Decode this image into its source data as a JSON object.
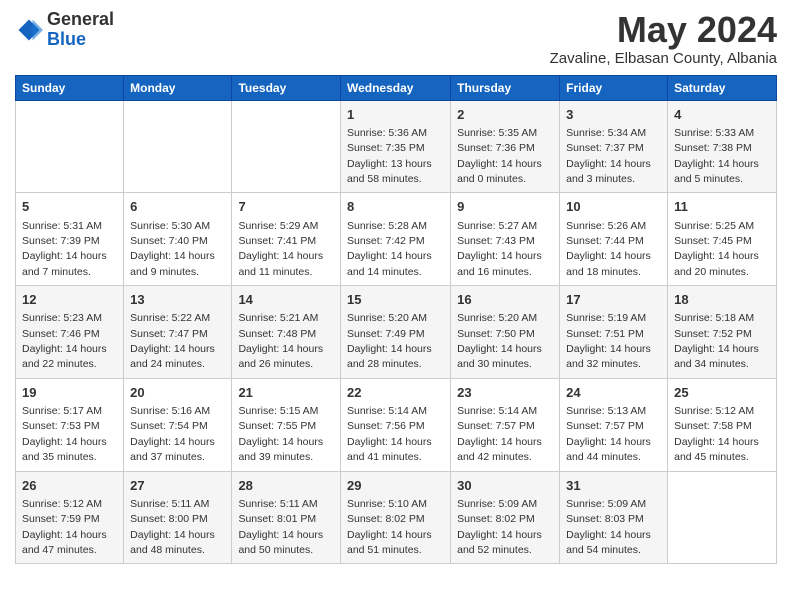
{
  "logo": {
    "general": "General",
    "blue": "Blue"
  },
  "title": "May 2024",
  "location": "Zavaline, Elbasan County, Albania",
  "days_of_week": [
    "Sunday",
    "Monday",
    "Tuesday",
    "Wednesday",
    "Thursday",
    "Friday",
    "Saturday"
  ],
  "weeks": [
    [
      {
        "day": "",
        "info": ""
      },
      {
        "day": "",
        "info": ""
      },
      {
        "day": "",
        "info": ""
      },
      {
        "day": "1",
        "info": "Sunrise: 5:36 AM\nSunset: 7:35 PM\nDaylight: 13 hours and 58 minutes."
      },
      {
        "day": "2",
        "info": "Sunrise: 5:35 AM\nSunset: 7:36 PM\nDaylight: 14 hours and 0 minutes."
      },
      {
        "day": "3",
        "info": "Sunrise: 5:34 AM\nSunset: 7:37 PM\nDaylight: 14 hours and 3 minutes."
      },
      {
        "day": "4",
        "info": "Sunrise: 5:33 AM\nSunset: 7:38 PM\nDaylight: 14 hours and 5 minutes."
      }
    ],
    [
      {
        "day": "5",
        "info": "Sunrise: 5:31 AM\nSunset: 7:39 PM\nDaylight: 14 hours and 7 minutes."
      },
      {
        "day": "6",
        "info": "Sunrise: 5:30 AM\nSunset: 7:40 PM\nDaylight: 14 hours and 9 minutes."
      },
      {
        "day": "7",
        "info": "Sunrise: 5:29 AM\nSunset: 7:41 PM\nDaylight: 14 hours and 11 minutes."
      },
      {
        "day": "8",
        "info": "Sunrise: 5:28 AM\nSunset: 7:42 PM\nDaylight: 14 hours and 14 minutes."
      },
      {
        "day": "9",
        "info": "Sunrise: 5:27 AM\nSunset: 7:43 PM\nDaylight: 14 hours and 16 minutes."
      },
      {
        "day": "10",
        "info": "Sunrise: 5:26 AM\nSunset: 7:44 PM\nDaylight: 14 hours and 18 minutes."
      },
      {
        "day": "11",
        "info": "Sunrise: 5:25 AM\nSunset: 7:45 PM\nDaylight: 14 hours and 20 minutes."
      }
    ],
    [
      {
        "day": "12",
        "info": "Sunrise: 5:23 AM\nSunset: 7:46 PM\nDaylight: 14 hours and 22 minutes."
      },
      {
        "day": "13",
        "info": "Sunrise: 5:22 AM\nSunset: 7:47 PM\nDaylight: 14 hours and 24 minutes."
      },
      {
        "day": "14",
        "info": "Sunrise: 5:21 AM\nSunset: 7:48 PM\nDaylight: 14 hours and 26 minutes."
      },
      {
        "day": "15",
        "info": "Sunrise: 5:20 AM\nSunset: 7:49 PM\nDaylight: 14 hours and 28 minutes."
      },
      {
        "day": "16",
        "info": "Sunrise: 5:20 AM\nSunset: 7:50 PM\nDaylight: 14 hours and 30 minutes."
      },
      {
        "day": "17",
        "info": "Sunrise: 5:19 AM\nSunset: 7:51 PM\nDaylight: 14 hours and 32 minutes."
      },
      {
        "day": "18",
        "info": "Sunrise: 5:18 AM\nSunset: 7:52 PM\nDaylight: 14 hours and 34 minutes."
      }
    ],
    [
      {
        "day": "19",
        "info": "Sunrise: 5:17 AM\nSunset: 7:53 PM\nDaylight: 14 hours and 35 minutes."
      },
      {
        "day": "20",
        "info": "Sunrise: 5:16 AM\nSunset: 7:54 PM\nDaylight: 14 hours and 37 minutes."
      },
      {
        "day": "21",
        "info": "Sunrise: 5:15 AM\nSunset: 7:55 PM\nDaylight: 14 hours and 39 minutes."
      },
      {
        "day": "22",
        "info": "Sunrise: 5:14 AM\nSunset: 7:56 PM\nDaylight: 14 hours and 41 minutes."
      },
      {
        "day": "23",
        "info": "Sunrise: 5:14 AM\nSunset: 7:57 PM\nDaylight: 14 hours and 42 minutes."
      },
      {
        "day": "24",
        "info": "Sunrise: 5:13 AM\nSunset: 7:57 PM\nDaylight: 14 hours and 44 minutes."
      },
      {
        "day": "25",
        "info": "Sunrise: 5:12 AM\nSunset: 7:58 PM\nDaylight: 14 hours and 45 minutes."
      }
    ],
    [
      {
        "day": "26",
        "info": "Sunrise: 5:12 AM\nSunset: 7:59 PM\nDaylight: 14 hours and 47 minutes."
      },
      {
        "day": "27",
        "info": "Sunrise: 5:11 AM\nSunset: 8:00 PM\nDaylight: 14 hours and 48 minutes."
      },
      {
        "day": "28",
        "info": "Sunrise: 5:11 AM\nSunset: 8:01 PM\nDaylight: 14 hours and 50 minutes."
      },
      {
        "day": "29",
        "info": "Sunrise: 5:10 AM\nSunset: 8:02 PM\nDaylight: 14 hours and 51 minutes."
      },
      {
        "day": "30",
        "info": "Sunrise: 5:09 AM\nSunset: 8:02 PM\nDaylight: 14 hours and 52 minutes."
      },
      {
        "day": "31",
        "info": "Sunrise: 5:09 AM\nSunset: 8:03 PM\nDaylight: 14 hours and 54 minutes."
      },
      {
        "day": "",
        "info": ""
      }
    ]
  ]
}
